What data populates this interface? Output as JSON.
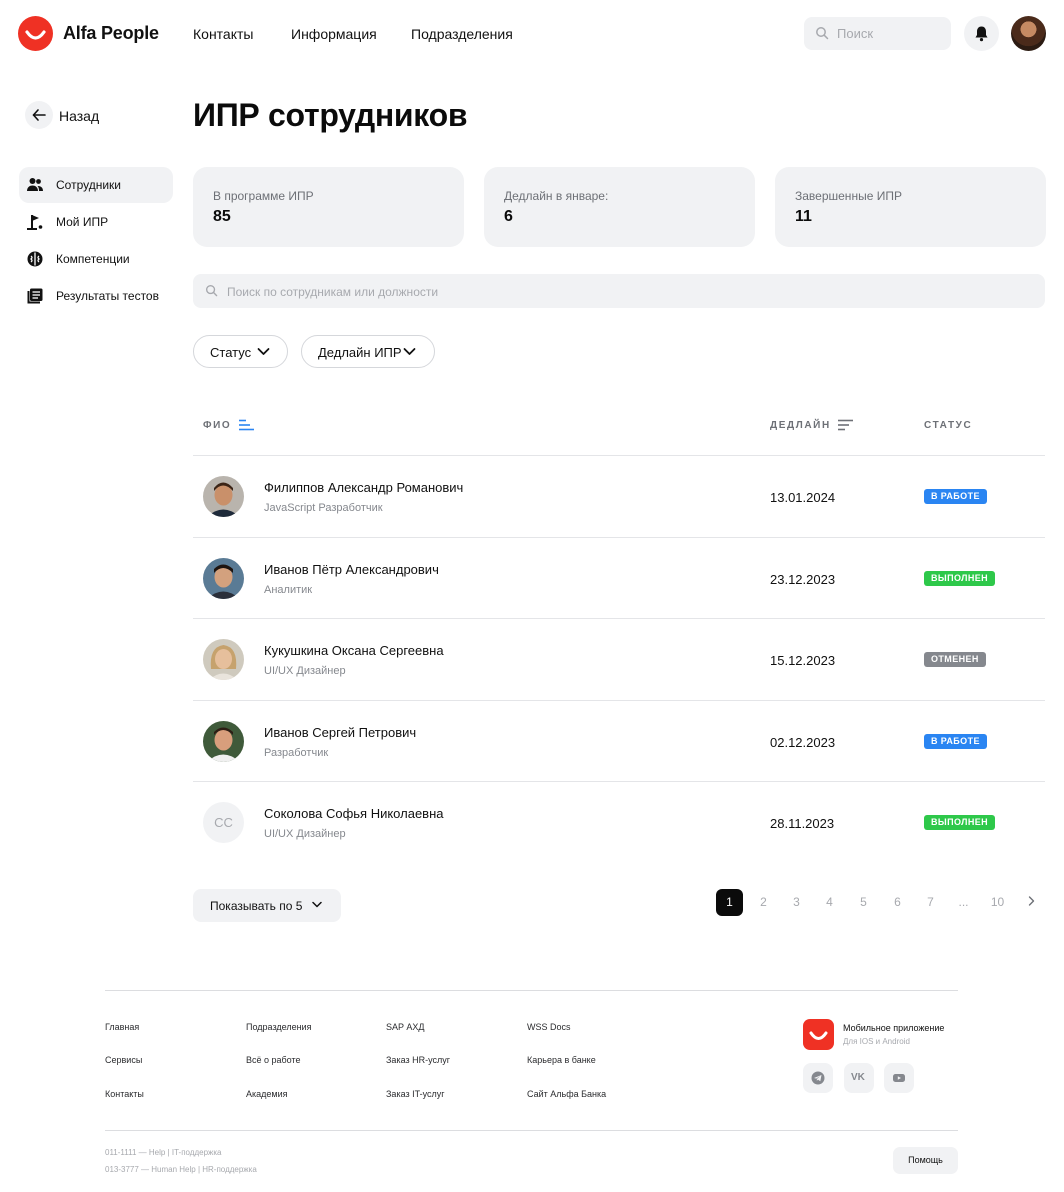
{
  "header": {
    "brand": "Alfa People",
    "nav": [
      "Контакты",
      "Информация",
      "Подразделения"
    ],
    "search_placeholder": "Поиск"
  },
  "sidebar": {
    "back_label": "Назад",
    "items": [
      {
        "label": "Сотрудники",
        "icon": "users-icon",
        "active": true
      },
      {
        "label": "Мой ИПР",
        "icon": "flag-icon",
        "active": false
      },
      {
        "label": "Компетенции",
        "icon": "brain-icon",
        "active": false
      },
      {
        "label": "Результаты тестов",
        "icon": "tests-icon",
        "active": false
      }
    ]
  },
  "main": {
    "title": "ИПР сотрудников",
    "stats": [
      {
        "label": "В программе ИПР",
        "value": "85"
      },
      {
        "label": "Дедлайн в январе:",
        "value": "6"
      },
      {
        "label": "Завершенные ИПР",
        "value": "11"
      }
    ],
    "search_placeholder": "Поиск по сотрудникам или должности",
    "filters": [
      "Статус",
      "Дедлайн ИПР"
    ],
    "table": {
      "columns": [
        "ФИО",
        "ДЕДЛАЙН",
        "СТАТУС"
      ],
      "rows": [
        {
          "name": "Филиппов Александр Романович",
          "role": "JavaScript Разработчик",
          "deadline": "13.01.2024",
          "status": "В РАБОТЕ",
          "status_color": "#2a85f2",
          "avatar": "photo"
        },
        {
          "name": "Иванов Пётр Александрович",
          "role": "Аналитик",
          "deadline": "23.12.2023",
          "status": "ВЫПОЛНЕН",
          "status_color": "#2ec84a",
          "avatar": "photo"
        },
        {
          "name": "Кукушкина Оксана Сергеевна",
          "role": "UI/UX Дизайнер",
          "deadline": "15.12.2023",
          "status": "ОТМЕНЕН",
          "status_color": "#85888e",
          "avatar": "photo"
        },
        {
          "name": "Иванов Сергей Петрович",
          "role": "Разработчик",
          "deadline": "02.12.2023",
          "status": "В РАБОТЕ",
          "status_color": "#2a85f2",
          "avatar": "photo"
        },
        {
          "name": "Соколова Софья Николаевна",
          "role": "UI/UX Дизайнер",
          "deadline": "28.11.2023",
          "status": "ВЫПОЛНЕН",
          "status_color": "#2ec84a",
          "avatar": "initials",
          "initials": "CC"
        }
      ]
    },
    "page_size_label": "Показывать по 5",
    "pagination": [
      "1",
      "2",
      "3",
      "4",
      "5",
      "6",
      "7",
      "...",
      "10"
    ],
    "current_page": "1"
  },
  "footer": {
    "columns": [
      [
        "Главная",
        "Сервисы",
        "Контакты"
      ],
      [
        "Подразделения",
        "Всё о работе",
        "Академия"
      ],
      [
        "SAP АХД",
        "Заказ HR-услуг",
        "Заказ IT-услуг"
      ],
      [
        "WSS Docs",
        "Карьера в банке",
        "Сайт Альфа Банка"
      ]
    ],
    "app_title": "Мобильное приложение",
    "app_subtitle": "Для IOS и Android",
    "socials": [
      "telegram-icon",
      "vk-icon",
      "youtube-icon"
    ],
    "vk_text": "VK",
    "contacts": [
      "011-1111 — Help | IT-поддержка",
      "013-3777 — Human Help | HR-поддержка"
    ],
    "help_label": "Помощь"
  },
  "colors": {
    "brand_red": "#ef3124",
    "surface": "#f1f2f4",
    "in_progress": "#2a85f2",
    "done": "#2ec84a",
    "cancelled": "#85888e"
  }
}
